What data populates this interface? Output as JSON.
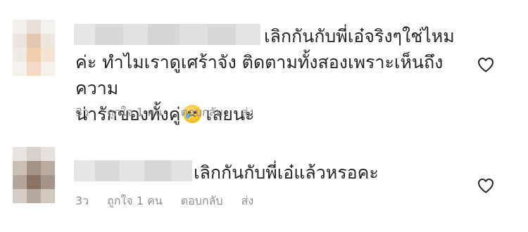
{
  "comments": [
    {
      "lines": [
        "เลิกกันกับพี่เอ๋จริงๆใช่ไหม",
        "ค่ะ ทำไมเราดูเศร้าจัง ติดตามทั้งสองเพราะเห็นถึงความ",
        "น่ารักของทั้งคู่"
      ],
      "tail": "เลยนะ",
      "emoji": "crying-face-icon",
      "time": "3ว",
      "likes": "ถูกใจ 1 คน",
      "reply": "ตอบกลับ",
      "send": "ส่ง"
    },
    {
      "lines": [
        "เลิกกันกับพี่เอ๋แล้วหรอคะ"
      ],
      "time": "3ว",
      "likes": "ถูกใจ 1 คน",
      "reply": "ตอบกลับ",
      "send": "ส่ง"
    }
  ],
  "colors": {
    "text": "#262626",
    "meta": "#8e8e8e",
    "heart_stroke": "#262626"
  }
}
